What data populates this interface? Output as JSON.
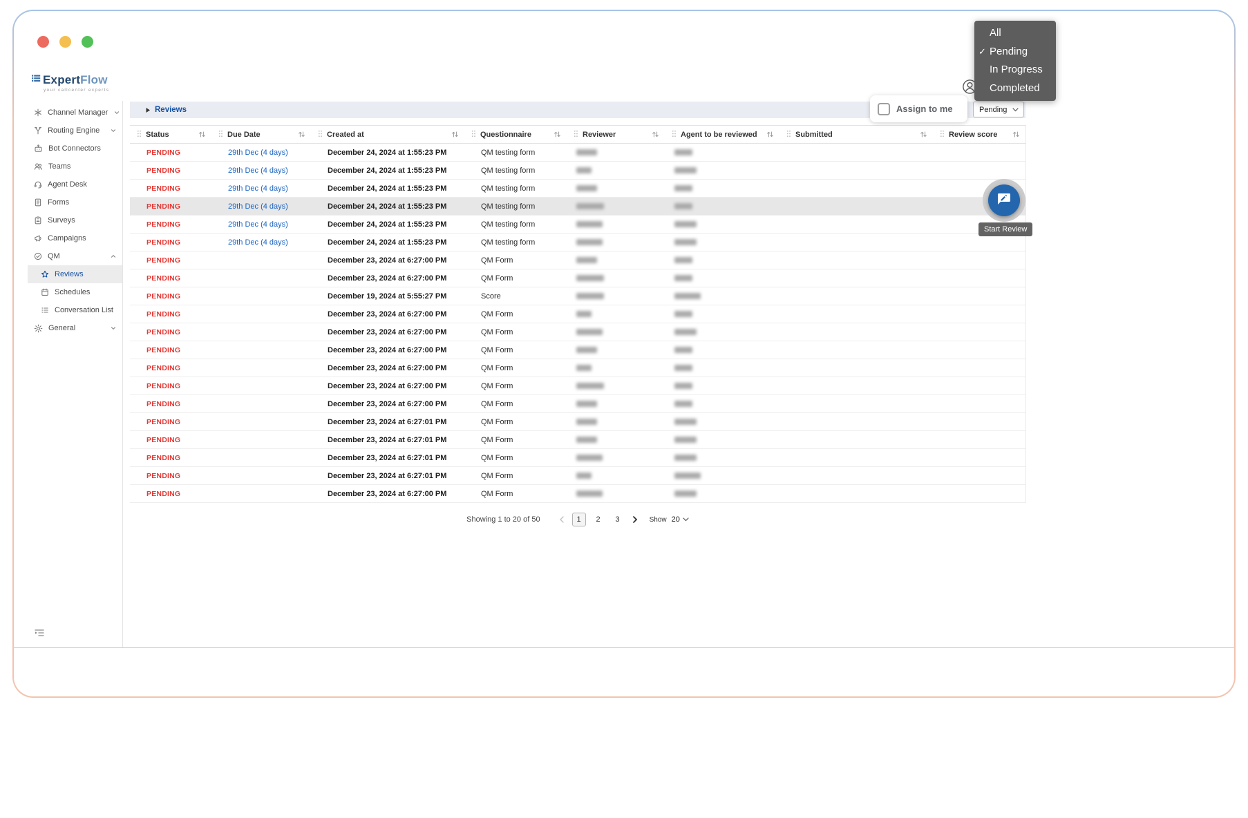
{
  "window": {
    "traffic_lights": [
      "close",
      "minimize",
      "zoom"
    ]
  },
  "brand": {
    "name_primary": "Expert",
    "name_secondary": "Flow",
    "tagline": "your callcenter experts"
  },
  "sidebar": {
    "items": [
      {
        "id": "channel-manager",
        "label": "Channel Manager",
        "chevron": "down"
      },
      {
        "id": "routing-engine",
        "label": "Routing Engine",
        "chevron": "down"
      },
      {
        "id": "bot-connectors",
        "label": "Bot Connectors"
      },
      {
        "id": "teams",
        "label": "Teams"
      },
      {
        "id": "agent-desk",
        "label": "Agent Desk"
      },
      {
        "id": "forms",
        "label": "Forms"
      },
      {
        "id": "surveys",
        "label": "Surveys"
      },
      {
        "id": "campaigns",
        "label": "Campaigns"
      },
      {
        "id": "qm",
        "label": "QM",
        "chevron": "up",
        "expanded": true,
        "children": [
          {
            "id": "reviews",
            "label": "Reviews",
            "active": true
          },
          {
            "id": "schedules",
            "label": "Schedules"
          },
          {
            "id": "conversation-list",
            "label": "Conversation List"
          }
        ]
      },
      {
        "id": "general",
        "label": "General",
        "chevron": "down"
      }
    ]
  },
  "toolbar": {
    "breadcrumb": "Reviews",
    "assign_label": "Assign to me",
    "assign_checked": false,
    "filter_value": "Pending"
  },
  "filter_menu": {
    "options": [
      {
        "label": "All",
        "selected": false
      },
      {
        "label": "Pending",
        "selected": true
      },
      {
        "label": "In Progress",
        "selected": false
      },
      {
        "label": "Completed",
        "selected": false
      }
    ]
  },
  "table": {
    "columns": [
      "Status",
      "Due Date",
      "Created at",
      "Questionnaire",
      "Reviewer",
      "Agent to be reviewed",
      "Submitted",
      "Review score"
    ],
    "rows": [
      {
        "status": "PENDING",
        "due": "29th Dec (4 days)",
        "created": "December 24, 2024 at 1:55:23 PM",
        "questionnaire": "QM testing form",
        "reviewer_redacted": 30,
        "agent_redacted": 26,
        "submitted": "",
        "score": "",
        "highlight": false
      },
      {
        "status": "PENDING",
        "due": "29th Dec (4 days)",
        "created": "December 24, 2024 at 1:55:23 PM",
        "questionnaire": "QM testing form",
        "reviewer_redacted": 22,
        "agent_redacted": 32,
        "submitted": "",
        "score": "",
        "highlight": false
      },
      {
        "status": "PENDING",
        "due": "29th Dec (4 days)",
        "created": "December 24, 2024 at 1:55:23 PM",
        "questionnaire": "QM testing form",
        "reviewer_redacted": 30,
        "agent_redacted": 26,
        "submitted": "",
        "score": "",
        "highlight": false
      },
      {
        "status": "PENDING",
        "due": "29th Dec (4 days)",
        "created": "December 24, 2024 at 1:55:23 PM",
        "questionnaire": "QM testing form",
        "reviewer_redacted": 40,
        "agent_redacted": 26,
        "submitted": "",
        "score": "",
        "highlight": true
      },
      {
        "status": "PENDING",
        "due": "29th Dec (4 days)",
        "created": "December 24, 2024 at 1:55:23 PM",
        "questionnaire": "QM testing form",
        "reviewer_redacted": 38,
        "agent_redacted": 32,
        "submitted": "",
        "score": "",
        "highlight": false
      },
      {
        "status": "PENDING",
        "due": "29th Dec (4 days)",
        "created": "December 24, 2024 at 1:55:23 PM",
        "questionnaire": "QM testing form",
        "reviewer_redacted": 38,
        "agent_redacted": 32,
        "submitted": "",
        "score": "",
        "highlight": false
      },
      {
        "status": "PENDING",
        "due": "",
        "created": "December 23, 2024 at 6:27:00 PM",
        "questionnaire": "QM Form",
        "reviewer_redacted": 30,
        "agent_redacted": 26,
        "submitted": "",
        "score": "",
        "highlight": false
      },
      {
        "status": "PENDING",
        "due": "",
        "created": "December 23, 2024 at 6:27:00 PM",
        "questionnaire": "QM Form",
        "reviewer_redacted": 40,
        "agent_redacted": 26,
        "submitted": "",
        "score": "",
        "highlight": false
      },
      {
        "status": "PENDING",
        "due": "",
        "created": "December 19, 2024 at 5:55:27 PM",
        "questionnaire": "Score",
        "reviewer_redacted": 40,
        "agent_redacted": 38,
        "submitted": "",
        "score": "",
        "highlight": false
      },
      {
        "status": "PENDING",
        "due": "",
        "created": "December 23, 2024 at 6:27:00 PM",
        "questionnaire": "QM Form",
        "reviewer_redacted": 22,
        "agent_redacted": 26,
        "submitted": "",
        "score": "",
        "highlight": false
      },
      {
        "status": "PENDING",
        "due": "",
        "created": "December 23, 2024 at 6:27:00 PM",
        "questionnaire": "QM Form",
        "reviewer_redacted": 38,
        "agent_redacted": 32,
        "submitted": "",
        "score": "",
        "highlight": false
      },
      {
        "status": "PENDING",
        "due": "",
        "created": "December 23, 2024 at 6:27:00 PM",
        "questionnaire": "QM Form",
        "reviewer_redacted": 30,
        "agent_redacted": 26,
        "submitted": "",
        "score": "",
        "highlight": false
      },
      {
        "status": "PENDING",
        "due": "",
        "created": "December 23, 2024 at 6:27:00 PM",
        "questionnaire": "QM Form",
        "reviewer_redacted": 22,
        "agent_redacted": 26,
        "submitted": "",
        "score": "",
        "highlight": false
      },
      {
        "status": "PENDING",
        "due": "",
        "created": "December 23, 2024 at 6:27:00 PM",
        "questionnaire": "QM Form",
        "reviewer_redacted": 40,
        "agent_redacted": 26,
        "submitted": "",
        "score": "",
        "highlight": false
      },
      {
        "status": "PENDING",
        "due": "",
        "created": "December 23, 2024 at 6:27:00 PM",
        "questionnaire": "QM Form",
        "reviewer_redacted": 30,
        "agent_redacted": 26,
        "submitted": "",
        "score": "",
        "highlight": false
      },
      {
        "status": "PENDING",
        "due": "",
        "created": "December 23, 2024 at 6:27:01 PM",
        "questionnaire": "QM Form",
        "reviewer_redacted": 30,
        "agent_redacted": 32,
        "submitted": "",
        "score": "",
        "highlight": false
      },
      {
        "status": "PENDING",
        "due": "",
        "created": "December 23, 2024 at 6:27:01 PM",
        "questionnaire": "QM Form",
        "reviewer_redacted": 30,
        "agent_redacted": 32,
        "submitted": "",
        "score": "",
        "highlight": false
      },
      {
        "status": "PENDING",
        "due": "",
        "created": "December 23, 2024 at 6:27:01 PM",
        "questionnaire": "QM Form",
        "reviewer_redacted": 38,
        "agent_redacted": 32,
        "submitted": "",
        "score": "",
        "highlight": false
      },
      {
        "status": "PENDING",
        "due": "",
        "created": "December 23, 2024 at 6:27:01 PM",
        "questionnaire": "QM Form",
        "reviewer_redacted": 22,
        "agent_redacted": 38,
        "submitted": "",
        "score": "",
        "highlight": false
      },
      {
        "status": "PENDING",
        "due": "",
        "created": "December 23, 2024 at 6:27:00 PM",
        "questionnaire": "QM Form",
        "reviewer_redacted": 38,
        "agent_redacted": 32,
        "submitted": "",
        "score": "",
        "highlight": false
      }
    ]
  },
  "pagination": {
    "summary": "Showing 1 to 20 of 50",
    "pages": [
      "1",
      "2",
      "3"
    ],
    "active_page": "1",
    "show_label": "Show",
    "page_size": "20"
  },
  "fab": {
    "tooltip": "Start Review"
  },
  "colors": {
    "pending_red": "#e53935",
    "link_blue": "#1663c7",
    "accent_blue": "#1653a6",
    "fab_blue": "#2366ad",
    "menu_gray": "#5d5d5d",
    "frame_top": "#a7c4e6",
    "frame_side": "#f3c3ae"
  }
}
